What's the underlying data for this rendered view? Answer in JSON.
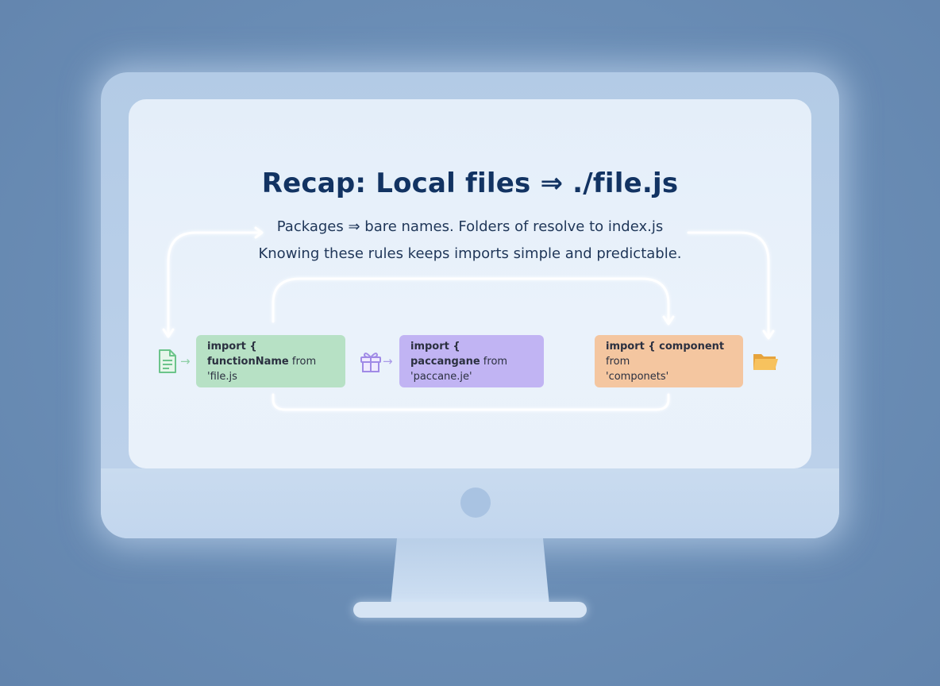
{
  "slide": {
    "title": "Recap: Local files ⇒ ./file.js",
    "subtitle_line1": "Packages ⇒ bare names. Folders of resolve to index.js",
    "subtitle_line2": "Knowing these rules keeps imports simple and predictable."
  },
  "cards": [
    {
      "keyword": "import { functionName",
      "rest": " from",
      "line2": "'file.js",
      "color": "#b7e1c5",
      "icon": "file-icon"
    },
    {
      "keyword": "import { paccangane",
      "rest": " from",
      "line2": "'paccane.je'",
      "color": "#c1b4f3",
      "icon": "gift-icon"
    },
    {
      "keyword": "import { component",
      "rest": " from",
      "line2": "'componets'",
      "color": "#f4c6a0",
      "icon": "folder-icon"
    }
  ],
  "colors": {
    "title": "#123362",
    "screen": "#e7f0fa",
    "monitor_frame": "#b8cee8",
    "background": "#6a8db5"
  }
}
